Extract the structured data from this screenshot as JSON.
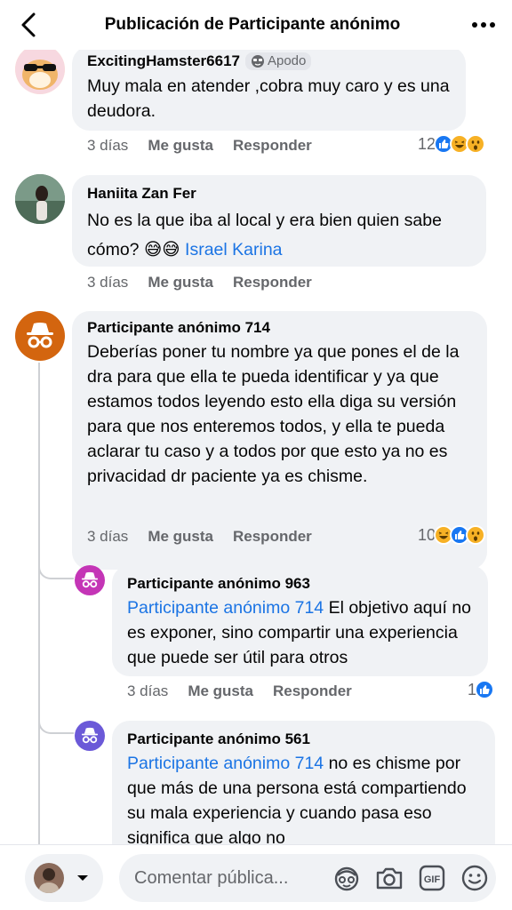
{
  "header": {
    "title": "Publicación de Participante anónimo"
  },
  "comments": [
    {
      "author": "ExcitingHamster6617",
      "badge": "Apodo",
      "text": "Muy mala en atender ,cobra muy caro  y es una deudora.",
      "time": "3 días",
      "like": "Me gusta",
      "reply": "Responder",
      "reaction_count": "12",
      "reactions": [
        "like",
        "haha",
        "wow"
      ]
    },
    {
      "author": "Haniita Zan Fer",
      "text": "No es la que iba al local y era bien quien sabe cómo?",
      "emoji": "😅😅",
      "mention": "Israel Karina",
      "time": "3 días",
      "like": "Me gusta",
      "reply": "Responder"
    },
    {
      "author": "Participante anónimo 714",
      "text": "Deberías poner tu nombre ya que pones el de la dra para que  ella te pueda identificar  y ya que estamos todos leyendo esto ella diga su versión para que nos enteremos todos, y ella te pueda aclarar tu caso y a todos por que esto ya no es privacidad dr paciente ya es chisme.",
      "time": "3 días",
      "like": "Me gusta",
      "reply": "Responder",
      "reaction_count": "10",
      "reactions": [
        "haha",
        "like",
        "wow"
      ]
    },
    {
      "author": "Participante anónimo 963",
      "mention": "Participante anónimo 714",
      "text": " El objetivo aquí no es exponer, sino compartir una experiencia que puede ser útil para otros",
      "time": "3 días",
      "like": "Me gusta",
      "reply": "Responder",
      "reaction_count": "1",
      "reactions": [
        "like"
      ]
    },
    {
      "author": "Participante anónimo 561",
      "mention": "Participante anónimo 714",
      "text": " no es chisme por que más de una persona está compartiendo su mala experiencia y cuando pasa eso significa que algo no"
    }
  ],
  "composer": {
    "placeholder": "Comentar pública..."
  },
  "colors": {
    "bubble": "#f0f2f5",
    "mention": "#1b74e4",
    "anon_714": "#d3650f",
    "anon_963": "#c435b6",
    "anon_561": "#6b59d8",
    "like": "#1877f2"
  },
  "icons": [
    "back-icon",
    "more-icon",
    "anonymous-icon",
    "like-reaction-icon",
    "haha-reaction-icon",
    "wow-reaction-icon",
    "dropdown-icon",
    "avatar-sticker-icon",
    "camera-icon",
    "gif-icon",
    "emoji-icon"
  ]
}
